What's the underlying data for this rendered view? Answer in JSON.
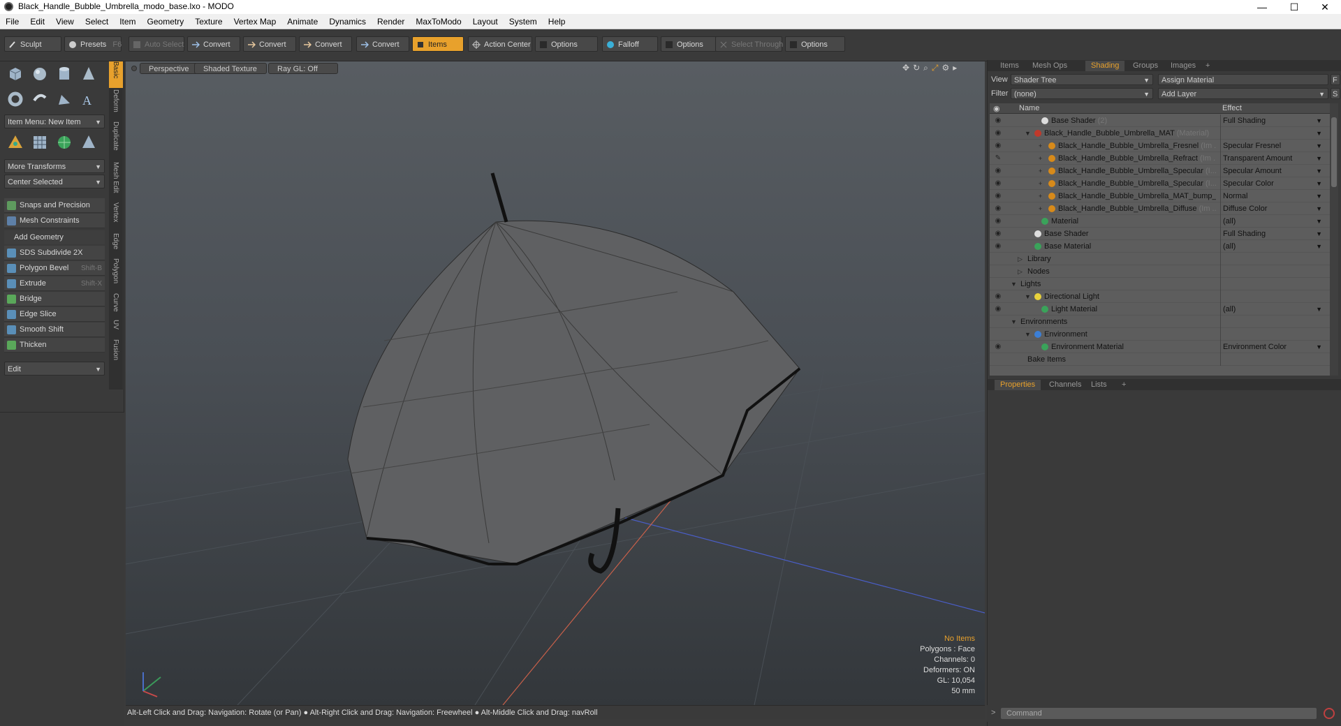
{
  "window": {
    "title": "Black_Handle_Bubble_Umbrella_modo_base.lxo - MODO",
    "min": "—",
    "max": "☐",
    "close": "✕"
  },
  "menu": [
    "File",
    "Edit",
    "View",
    "Select",
    "Item",
    "Geometry",
    "Texture",
    "Vertex Map",
    "Animate",
    "Dynamics",
    "Render",
    "MaxToModo",
    "Layout",
    "System",
    "Help"
  ],
  "toolbar": {
    "sculpt": "Sculpt",
    "presets": "Presets",
    "presets_key": "F6",
    "auto_select": "Auto Select",
    "convert1": "Convert",
    "convert2": "Convert",
    "convert3": "Convert",
    "convert4": "Convert",
    "items": "Items",
    "action_center": "Action Center",
    "options1": "Options",
    "falloff": "Falloff",
    "options2": "Options",
    "select_through": "Select Through",
    "options3": "Options"
  },
  "left": {
    "item_menu": "Item Menu: New Item",
    "more_transforms": "More Transforms",
    "center_selected": "Center Selected",
    "snaps": "Snaps and Precision",
    "mesh_constraints": "Mesh Constraints",
    "add_geometry": "Add Geometry",
    "tools": [
      {
        "label": "SDS Subdivide 2X",
        "shortcut": ""
      },
      {
        "label": "Polygon Bevel",
        "shortcut": "Shift-B"
      },
      {
        "label": "Extrude",
        "shortcut": "Shift-X"
      },
      {
        "label": "Bridge",
        "shortcut": ""
      },
      {
        "label": "Edge Slice",
        "shortcut": ""
      },
      {
        "label": "Smooth Shift",
        "shortcut": ""
      },
      {
        "label": "Thicken",
        "shortcut": ""
      }
    ],
    "edit": "Edit",
    "vtabs": [
      "Basic",
      "Deform",
      "Duplicate",
      "Mesh Edit",
      "Vertex",
      "Edge",
      "Polygon",
      "Curve",
      "UV",
      "Fusion"
    ]
  },
  "viewport": {
    "perspective": "Perspective",
    "shading": "Shaded Texture",
    "raygl": "Ray GL: Off",
    "stats": {
      "no_items": "No Items",
      "polygons": "Polygons : Face",
      "channels": "Channels: 0",
      "deformers": "Deformers: ON",
      "gl": "GL: 10,054",
      "size": "50 mm"
    }
  },
  "status": "Alt-Left Click and Drag: Navigation: Rotate (or Pan) ● Alt-Right Click and Drag: Navigation: Freewheel ● Alt-Middle Click and Drag: navRoll",
  "right": {
    "tabs": [
      "Items",
      "Mesh Ops",
      "Shading",
      "Groups",
      "Images",
      "+"
    ],
    "view_label": "View",
    "view_value": "Shader Tree",
    "assign": "Assign Material",
    "f": "F",
    "filter_label": "Filter",
    "filter_value": "(none)",
    "add_layer": "Add Layer",
    "s": "S",
    "col_name": "Name",
    "col_effect": "Effect",
    "rows": [
      {
        "name": "Base Shader",
        "sub": "(2)",
        "effect": "Full Shading",
        "indent": 4,
        "color": "#dddddd",
        "eye": true,
        "dd": true
      },
      {
        "name": "Black_Handle_Bubble_Umbrella_MAT",
        "sub": "(Material)",
        "effect": "",
        "indent": 3,
        "color": "#c0392b",
        "eye": true,
        "dd": true,
        "tri": "▼"
      },
      {
        "name": "Black_Handle_Bubble_Umbrella_Fresnel",
        "sub": "(Im ...",
        "effect": "Specular Fresnel",
        "indent": 5,
        "color": "#d78a1a",
        "eye": true,
        "dd": true,
        "tri": "+"
      },
      {
        "name": "Black_Handle_Bubble_Umbrella_Refract",
        "sub": "(Im ...",
        "effect": "Transparent Amount",
        "indent": 5,
        "color": "#d78a1a",
        "eye": "brush",
        "dd": true,
        "tri": "+"
      },
      {
        "name": "Black_Handle_Bubble_Umbrella_Specular",
        "sub": "(I...",
        "effect": "Specular Amount",
        "indent": 5,
        "color": "#d78a1a",
        "eye": true,
        "dd": true,
        "tri": "+"
      },
      {
        "name": "Black_Handle_Bubble_Umbrella_Specular",
        "sub": "(I...",
        "effect": "Specular Color",
        "indent": 5,
        "color": "#d78a1a",
        "eye": true,
        "dd": true,
        "tri": "+"
      },
      {
        "name": "Black_Handle_Bubble_Umbrella_MAT_bump_...",
        "sub": "",
        "effect": "Normal",
        "indent": 5,
        "color": "#d78a1a",
        "eye": true,
        "dd": true,
        "tri": "+"
      },
      {
        "name": "Black_Handle_Bubble_Umbrella_Diffuse",
        "sub": "(Im ...",
        "effect": "Diffuse Color",
        "indent": 5,
        "color": "#d78a1a",
        "eye": true,
        "dd": true,
        "tri": "+"
      },
      {
        "name": "Material",
        "sub": "",
        "effect": "(all)",
        "indent": 4,
        "color": "#3aa35a",
        "eye": true,
        "dd": true
      },
      {
        "name": "Base Shader",
        "sub": "",
        "effect": "Full Shading",
        "indent": 3,
        "color": "#dddddd",
        "eye": true,
        "dd": true
      },
      {
        "name": "Base Material",
        "sub": "",
        "effect": "(all)",
        "indent": 3,
        "color": "#3aa35a",
        "eye": true,
        "dd": true
      },
      {
        "name": "Library",
        "sub": "",
        "effect": "",
        "indent": 2,
        "color": "",
        "eye": false,
        "tri": "▷"
      },
      {
        "name": "Nodes",
        "sub": "",
        "effect": "",
        "indent": 2,
        "color": "",
        "eye": false,
        "tri": "▷"
      },
      {
        "name": "Lights",
        "sub": "",
        "effect": "",
        "indent": 1,
        "color": "",
        "eye": false,
        "tri": "▼"
      },
      {
        "name": "Directional Light",
        "sub": "",
        "effect": "",
        "indent": 3,
        "color": "#e8d23c",
        "eye": true,
        "tri": "▼"
      },
      {
        "name": "Light Material",
        "sub": "",
        "effect": "(all)",
        "indent": 4,
        "color": "#3aa35a",
        "eye": true,
        "dd": true
      },
      {
        "name": "Environments",
        "sub": "",
        "effect": "",
        "indent": 1,
        "color": "",
        "eye": false,
        "tri": "▼"
      },
      {
        "name": "Environment",
        "sub": "",
        "effect": "",
        "indent": 3,
        "color": "#3c7fd6",
        "eye": false,
        "tri": "▼"
      },
      {
        "name": "Environment Material",
        "sub": "",
        "effect": "Environment Color",
        "indent": 4,
        "color": "#3aa35a",
        "eye": true,
        "dd": true
      },
      {
        "name": "Bake Items",
        "sub": "",
        "effect": "",
        "indent": 2,
        "color": "",
        "eye": false
      }
    ],
    "lower_tabs": [
      "Properties",
      "Channels",
      "Lists",
      "+"
    ],
    "command_placeholder": "Command"
  },
  "colors": {
    "accent": "#e8a12c"
  }
}
